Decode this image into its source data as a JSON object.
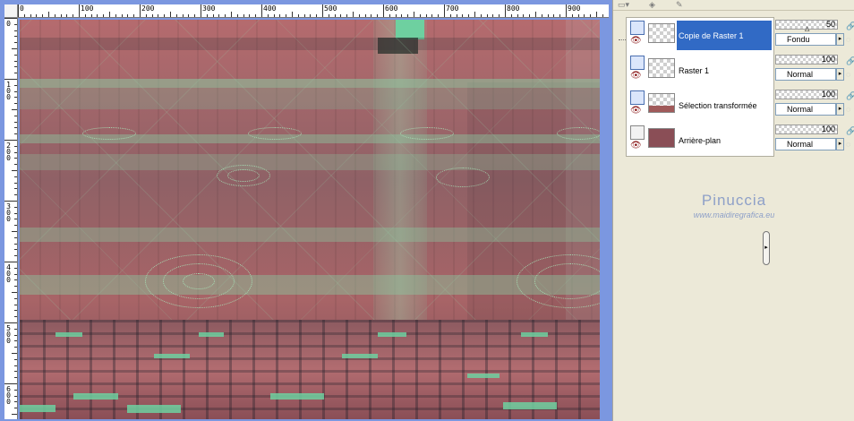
{
  "rulers": {
    "top": [
      "0",
      "100",
      "200",
      "300",
      "400",
      "500",
      "600",
      "700",
      "800",
      "900"
    ],
    "left": [
      "0",
      "1\n0\n0",
      "2\n0\n0",
      "3\n0\n0",
      "4\n0\n0",
      "5\n0\n0",
      "6\n0\n0"
    ]
  },
  "layers": [
    {
      "name": "Copie de Raster 1",
      "opacity": "50",
      "blend": "Fondu",
      "selected": true
    },
    {
      "name": "Raster 1",
      "opacity": "100",
      "blend": "Normal",
      "selected": false
    },
    {
      "name": "Sélection transformée",
      "opacity": "100",
      "blend": "Normal",
      "selected": false
    },
    {
      "name": "Arrière-plan",
      "opacity": "100",
      "blend": "Normal",
      "selected": false
    }
  ],
  "watermark": {
    "title": "Pinuccia",
    "url": "www.maidiregrafica.eu"
  },
  "colors": {
    "selection": "#316ac5",
    "panel_bg": "#ece9d8",
    "workspace": "#7b97e0",
    "canvas_pink": "#b56b6e",
    "canvas_green": "#6ed0a0"
  }
}
